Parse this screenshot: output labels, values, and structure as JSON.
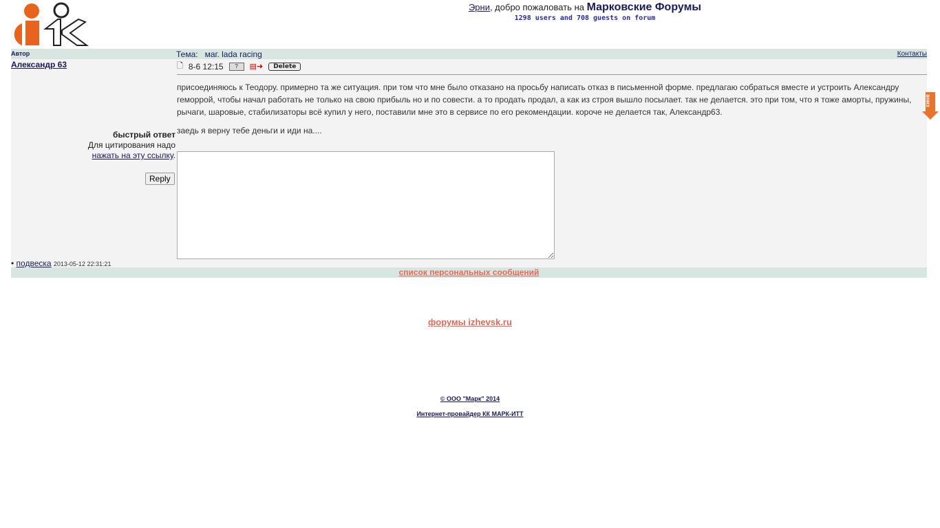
{
  "header": {
    "user": "Эрни",
    "welcome": ", добро пожаловать на ",
    "forum_name": "Марковские Форумы",
    "stats": "1298 users and 708 guests on forum"
  },
  "table_header": {
    "author_label": "Автор",
    "topic_label": "Тема:",
    "topic": "маг. lada racing",
    "contacts": "Контакты"
  },
  "post": {
    "author": "Александр 63",
    "time": "8-6 12:15",
    "delete_label": "Delete",
    "body": "присоединяюсь к Теодору. примерно та же ситуация. при том что мне было отказано на просьбу написать отказ в письменной форме. предлагаю собраться вместе и устроить Александру геморрой, чтобы начал работать не только на свою прибыль но и по совести. а то продать продал, а как из строя вышло посылает. так не делается. это при том, что я тоже аморты, пружины, рычаги, шаровые, стабилизаторы всё купил у него, поставили мне это в сервисе по его рекомендации. короче не делается так, Александр63.",
    "body2": "заедь я верну тебе деньги и иди на...."
  },
  "quick_reply": {
    "title": "быстрый ответ",
    "hint": "Для цитирования надо",
    "link": "нажать на эту ссылку",
    "reply_label": "Reply",
    "text": ""
  },
  "tag": {
    "label": "подвеска",
    "date": "2013-05-12 22:31:21"
  },
  "footer": {
    "pm_list": "список персональных сообщений",
    "forums": "форумы izhevsk.ru",
    "copyright": "© ООО \"Марк\" 2014",
    "isp": "Интернет-провайдер КК МАРК-ИТТ"
  },
  "scroll_down": "вниз",
  "colors": {
    "band": "#d8e6e1",
    "accent": "#e36a5a",
    "logo_orange": "#e8641e"
  }
}
